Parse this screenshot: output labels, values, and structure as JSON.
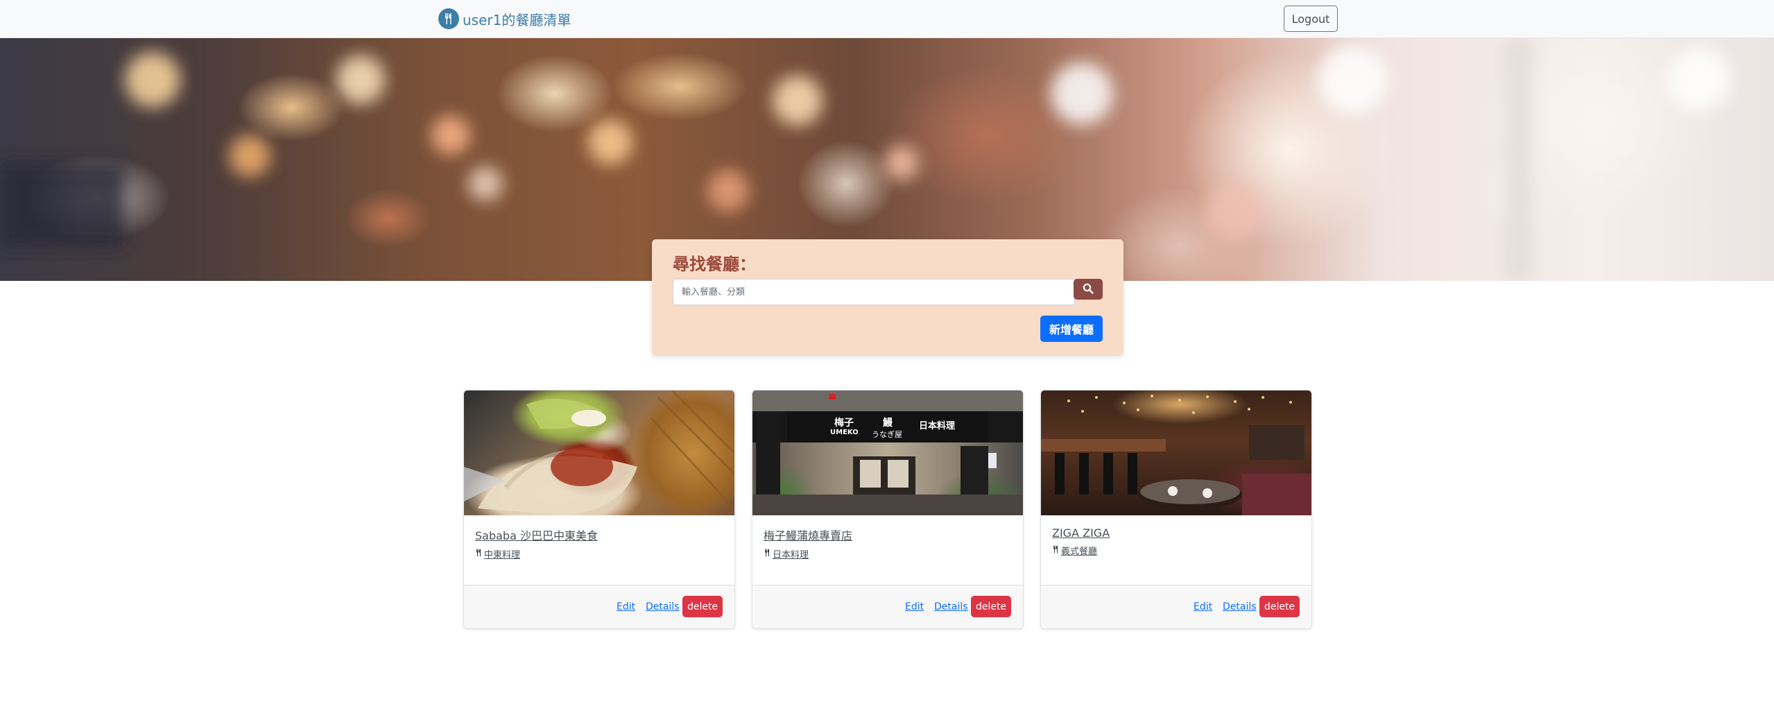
{
  "navbar": {
    "brand": "user1的餐廳清單",
    "brand_icon": "utensils-icon",
    "logout_label": "Logout"
  },
  "search": {
    "title": "尋找餐廳：",
    "placeholder": "輸入餐廳、分類",
    "value": "",
    "button_icon": "search-icon",
    "add_label": "新增餐廳"
  },
  "restaurants": [
    {
      "name": "Sababa 沙巴巴中東美食",
      "category": "中東料理",
      "edit_label": "Edit",
      "details_label": "Details",
      "delete_label": "delete"
    },
    {
      "name": "梅子鰻蒲燒專賣店",
      "category": "日本料理",
      "edit_label": "Edit",
      "details_label": "Details",
      "delete_label": "delete",
      "sign_text": [
        "梅子",
        "UMEKO",
        "鰻",
        "うなぎ屋",
        "日本料理"
      ]
    },
    {
      "name": "ZIGA ZIGA",
      "category": "義式餐廳",
      "edit_label": "Edit",
      "details_label": "Details",
      "delete_label": "delete"
    }
  ],
  "colors": {
    "brand": "#3d7ea6",
    "search_title": "#9c4a3e",
    "search_panel": "#f8dcc7",
    "search_button": "#8c4a44",
    "primary": "#0d6efd",
    "danger": "#dc3545"
  }
}
